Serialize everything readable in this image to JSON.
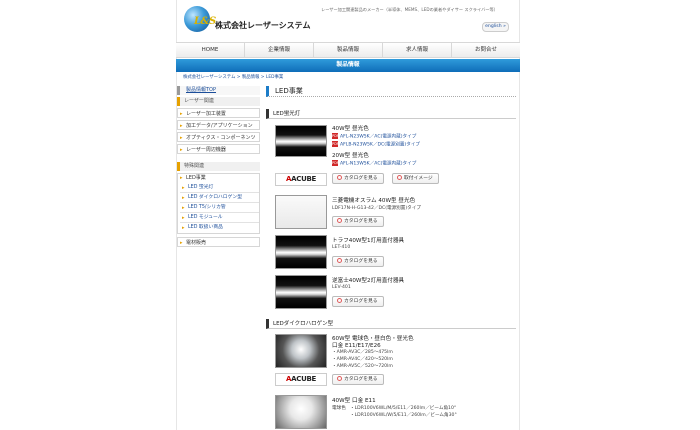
{
  "header": {
    "tagline": "レーザー加工関連製品のメーカー（半導体、MEMS、LEDの業者やダイサー スクライバー等）",
    "company_name": "株式会社レーザーシステム",
    "logo_text": "L&S",
    "english_button": "english »"
  },
  "global_nav": [
    "HOME",
    "企業情報",
    "製品情報",
    "求人情報",
    "お問合せ"
  ],
  "category_bar": "製品情報",
  "breadcrumb": "株式会社レーザーシステム > 製品情報 > LED事業",
  "sidebar": {
    "top_link": "製品情報TOP",
    "laser_heading": "レーザー関連",
    "laser_items": [
      "レーザー加工装置",
      "加工データ/アプリケーション",
      "オプティクス・コンポーネンツ",
      "レーザー周辺機器"
    ],
    "other_heading": "特殊関連",
    "led_label": "LED事業",
    "led_items": [
      "LED 蛍光灯",
      "LED ダイクロハロゲン型",
      "LED T5/シリカ管",
      "LED モジュール",
      "LED 取扱い商品"
    ],
    "misc_item": "電材販売"
  },
  "main": {
    "page_title": "LED事業",
    "section1": "LED蛍光灯",
    "section2": "LEDダイクロハロゲン型",
    "products": {
      "p1": {
        "title40": "40W型 昼光色",
        "link1": "AFL-N23W5K／AC(電源内蔵)タイプ",
        "link2": "AFLB-N23W5K／DC(電源別置)タイプ",
        "title20": "20W型 昼光色",
        "link3": "AFL-N13W5K／AC(電源内蔵)タイプ",
        "btn_catalog": "カタログを見る",
        "btn_install": "取付イメージ",
        "brand": "ACUBE"
      },
      "p2": {
        "title": "三菱電機オスラム 40W型 昼光色",
        "line": "LDF17N-H-G13-42／DC(電源別置)タイプ",
        "btn_catalog": "カタログを見る"
      },
      "p3": {
        "title": "トラフ40W型1灯用直付器具",
        "line": "LET-410",
        "btn_catalog": "カタログを見る"
      },
      "p4": {
        "title": "逆富士40W型2灯用直付器具",
        "line": "LEV-401",
        "btn_catalog": "カタログを見る"
      },
      "p5": {
        "title1": "60W型 電球色・昼白色・昼光色",
        "title2": "口金 E11/E17/E26",
        "line1": "・AMR-AV3C／285〜475lm",
        "line2": "・AMR-AV4C／420〜520lm",
        "line3": "・AMR-AV5C／520〜720lm",
        "btn_catalog": "カタログを見る",
        "brand": "ACUBE"
      },
      "p6": {
        "title": "40W型 口金 E11",
        "label": "電球色",
        "line1": "・LDR100V6WL/M/5/E11／260lm／ビーム角10°",
        "line2": "・LDR100V6WL/W/5/E11／260lm／ビーム角30°"
      }
    }
  }
}
